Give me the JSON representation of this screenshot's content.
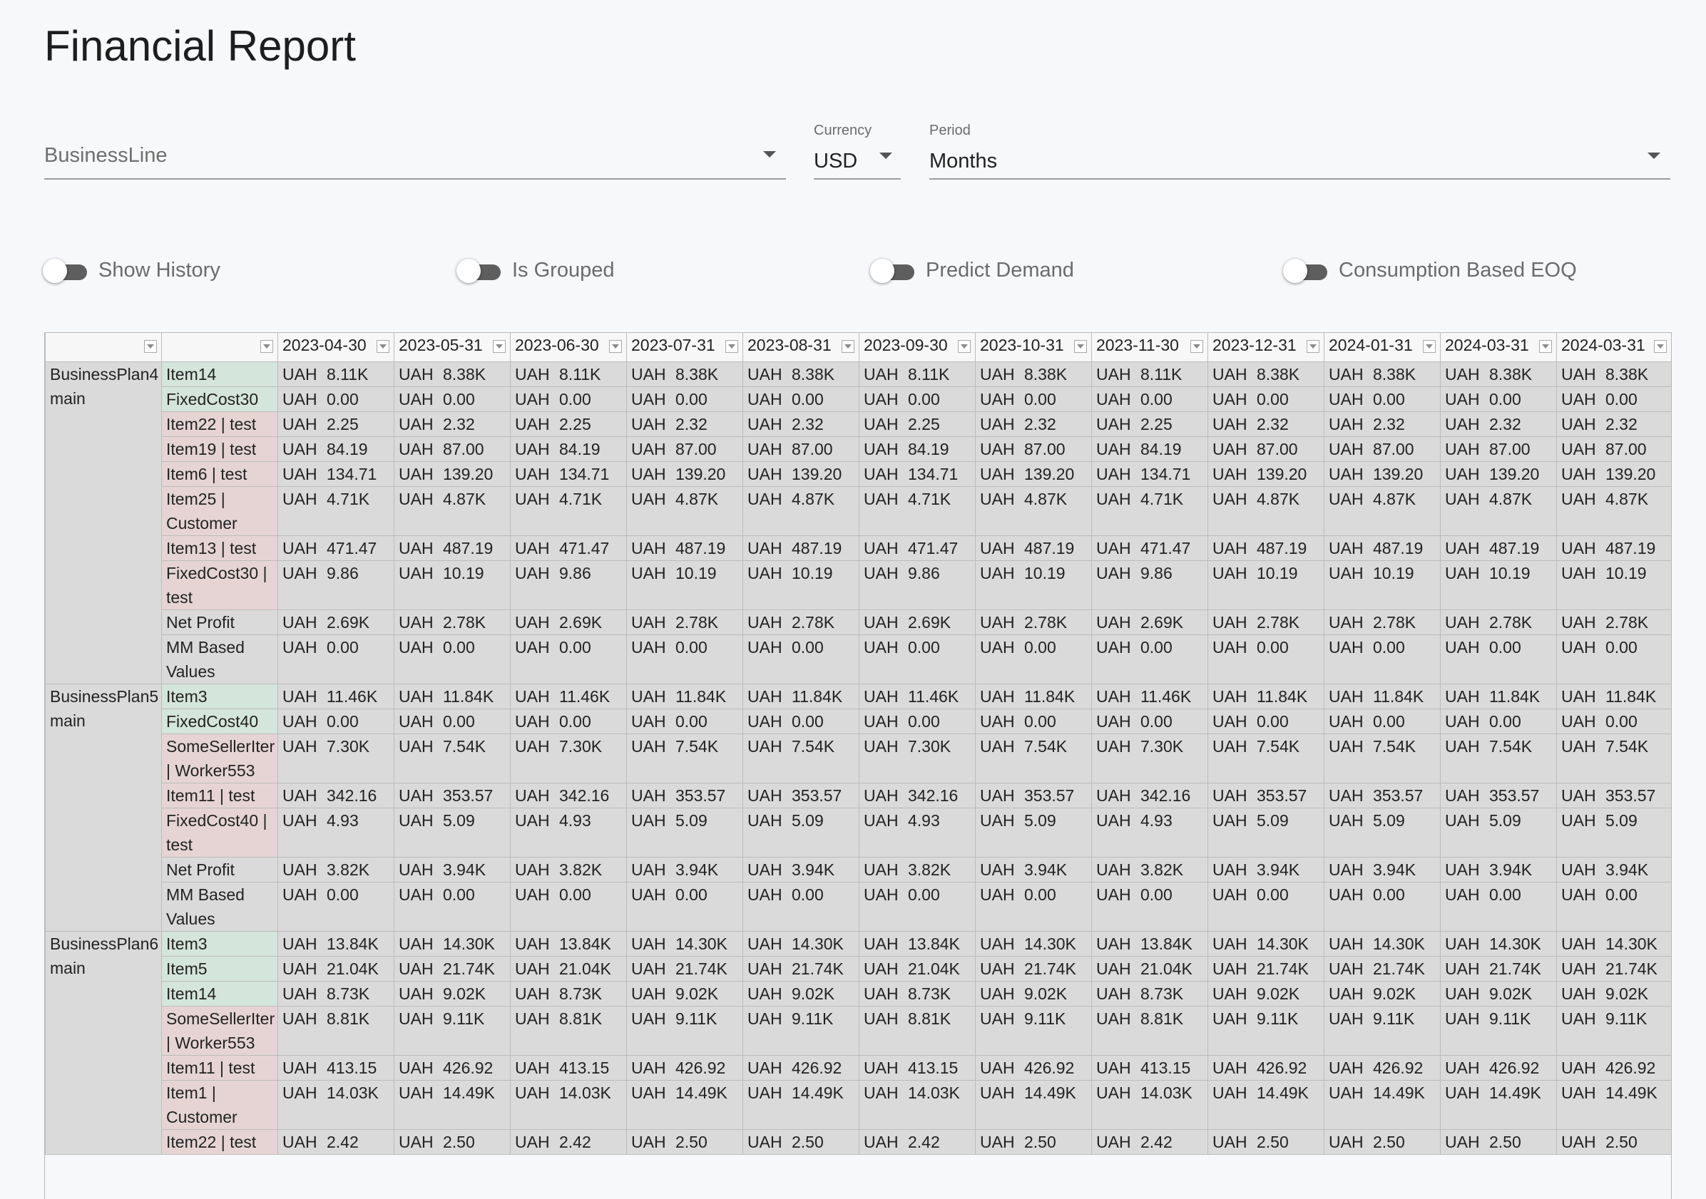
{
  "page": {
    "title": "Financial Report"
  },
  "filters": {
    "business_line": {
      "placeholder": "BusinessLine"
    },
    "currency": {
      "label": "Currency",
      "value": "USD"
    },
    "period": {
      "label": "Period",
      "value": "Months"
    }
  },
  "toggles": [
    {
      "label": "Show History",
      "on": false
    },
    {
      "label": "Is Grouped",
      "on": false
    },
    {
      "label": "Predict Demand",
      "on": false
    },
    {
      "label": "Consumption Based EOQ",
      "on": false
    }
  ],
  "colors": {
    "income_row": "#d4e5db",
    "cost_row": "#e6d4d4",
    "neutral_row": "#dadada"
  },
  "table": {
    "columns": [
      "2023-04-30",
      "2023-05-31",
      "2023-06-30",
      "2023-07-31",
      "2023-08-31",
      "2023-09-30",
      "2023-10-31",
      "2023-11-30",
      "2023-12-31",
      "2024-01-31",
      "2024-03-31",
      "2024-03-31"
    ],
    "groups": [
      {
        "plan": "BusinessPlan4 main",
        "rows": [
          {
            "label": "Item14",
            "kind": "green",
            "values": [
              "8.11K",
              "8.38K",
              "8.11K",
              "8.38K",
              "8.38K",
              "8.11K",
              "8.38K",
              "8.11K",
              "8.38K",
              "8.38K",
              "8.38K",
              "8.38K"
            ]
          },
          {
            "label": "FixedCost30",
            "kind": "green",
            "values": [
              "0.00",
              "0.00",
              "0.00",
              "0.00",
              "0.00",
              "0.00",
              "0.00",
              "0.00",
              "0.00",
              "0.00",
              "0.00",
              "0.00"
            ]
          },
          {
            "label": "Item22 | test",
            "kind": "red",
            "values": [
              "2.25",
              "2.32",
              "2.25",
              "2.32",
              "2.32",
              "2.25",
              "2.32",
              "2.25",
              "2.32",
              "2.32",
              "2.32",
              "2.32"
            ]
          },
          {
            "label": "Item19 | test",
            "kind": "red",
            "values": [
              "84.19",
              "87.00",
              "84.19",
              "87.00",
              "87.00",
              "84.19",
              "87.00",
              "84.19",
              "87.00",
              "87.00",
              "87.00",
              "87.00"
            ]
          },
          {
            "label": "Item6 | test",
            "kind": "red",
            "values": [
              "134.71",
              "139.20",
              "134.71",
              "139.20",
              "139.20",
              "134.71",
              "139.20",
              "134.71",
              "139.20",
              "139.20",
              "139.20",
              "139.20"
            ]
          },
          {
            "label": "Item25 | Customer",
            "kind": "red",
            "values": [
              "4.71K",
              "4.87K",
              "4.71K",
              "4.87K",
              "4.87K",
              "4.71K",
              "4.87K",
              "4.71K",
              "4.87K",
              "4.87K",
              "4.87K",
              "4.87K"
            ]
          },
          {
            "label": "Item13 | test",
            "kind": "red",
            "values": [
              "471.47",
              "487.19",
              "471.47",
              "487.19",
              "487.19",
              "471.47",
              "487.19",
              "471.47",
              "487.19",
              "487.19",
              "487.19",
              "487.19"
            ]
          },
          {
            "label": "FixedCost30 | test",
            "kind": "red",
            "values": [
              "9.86",
              "10.19",
              "9.86",
              "10.19",
              "10.19",
              "9.86",
              "10.19",
              "9.86",
              "10.19",
              "10.19",
              "10.19",
              "10.19"
            ]
          },
          {
            "label": "Net Profit",
            "kind": "neutral",
            "values": [
              "2.69K",
              "2.78K",
              "2.69K",
              "2.78K",
              "2.78K",
              "2.69K",
              "2.78K",
              "2.69K",
              "2.78K",
              "2.78K",
              "2.78K",
              "2.78K"
            ]
          },
          {
            "label": "MM Based Values",
            "kind": "neutral",
            "values": [
              "0.00",
              "0.00",
              "0.00",
              "0.00",
              "0.00",
              "0.00",
              "0.00",
              "0.00",
              "0.00",
              "0.00",
              "0.00",
              "0.00"
            ]
          }
        ]
      },
      {
        "plan": "BusinessPlan5 main",
        "rows": [
          {
            "label": "Item3",
            "kind": "green",
            "values": [
              "11.46K",
              "11.84K",
              "11.46K",
              "11.84K",
              "11.84K",
              "11.46K",
              "11.84K",
              "11.46K",
              "11.84K",
              "11.84K",
              "11.84K",
              "11.84K"
            ]
          },
          {
            "label": "FixedCost40",
            "kind": "green",
            "values": [
              "0.00",
              "0.00",
              "0.00",
              "0.00",
              "0.00",
              "0.00",
              "0.00",
              "0.00",
              "0.00",
              "0.00",
              "0.00",
              "0.00"
            ]
          },
          {
            "label": "SomeSellerIter | Worker553",
            "kind": "red",
            "values": [
              "7.30K",
              "7.54K",
              "7.30K",
              "7.54K",
              "7.54K",
              "7.30K",
              "7.54K",
              "7.30K",
              "7.54K",
              "7.54K",
              "7.54K",
              "7.54K"
            ]
          },
          {
            "label": "Item11 | test",
            "kind": "red",
            "values": [
              "342.16",
              "353.57",
              "342.16",
              "353.57",
              "353.57",
              "342.16",
              "353.57",
              "342.16",
              "353.57",
              "353.57",
              "353.57",
              "353.57"
            ]
          },
          {
            "label": "FixedCost40 | test",
            "kind": "red",
            "values": [
              "4.93",
              "5.09",
              "4.93",
              "5.09",
              "5.09",
              "4.93",
              "5.09",
              "4.93",
              "5.09",
              "5.09",
              "5.09",
              "5.09"
            ]
          },
          {
            "label": "Net Profit",
            "kind": "neutral",
            "values": [
              "3.82K",
              "3.94K",
              "3.82K",
              "3.94K",
              "3.94K",
              "3.82K",
              "3.94K",
              "3.82K",
              "3.94K",
              "3.94K",
              "3.94K",
              "3.94K"
            ]
          },
          {
            "label": "MM Based Values",
            "kind": "neutral",
            "values": [
              "0.00",
              "0.00",
              "0.00",
              "0.00",
              "0.00",
              "0.00",
              "0.00",
              "0.00",
              "0.00",
              "0.00",
              "0.00",
              "0.00"
            ]
          }
        ]
      },
      {
        "plan": "BusinessPlan6 main",
        "rows": [
          {
            "label": "Item3",
            "kind": "green",
            "values": [
              "13.84K",
              "14.30K",
              "13.84K",
              "14.30K",
              "14.30K",
              "13.84K",
              "14.30K",
              "13.84K",
              "14.30K",
              "14.30K",
              "14.30K",
              "14.30K"
            ]
          },
          {
            "label": "Item5",
            "kind": "green",
            "values": [
              "21.04K",
              "21.74K",
              "21.04K",
              "21.74K",
              "21.74K",
              "21.04K",
              "21.74K",
              "21.04K",
              "21.74K",
              "21.74K",
              "21.74K",
              "21.74K"
            ]
          },
          {
            "label": "Item14",
            "kind": "green",
            "values": [
              "8.73K",
              "9.02K",
              "8.73K",
              "9.02K",
              "9.02K",
              "8.73K",
              "9.02K",
              "8.73K",
              "9.02K",
              "9.02K",
              "9.02K",
              "9.02K"
            ]
          },
          {
            "label": "SomeSellerIter | Worker553",
            "kind": "red",
            "values": [
              "8.81K",
              "9.11K",
              "8.81K",
              "9.11K",
              "9.11K",
              "8.81K",
              "9.11K",
              "8.81K",
              "9.11K",
              "9.11K",
              "9.11K",
              "9.11K"
            ]
          },
          {
            "label": "Item11 | test",
            "kind": "red",
            "values": [
              "413.15",
              "426.92",
              "413.15",
              "426.92",
              "426.92",
              "413.15",
              "426.92",
              "413.15",
              "426.92",
              "426.92",
              "426.92",
              "426.92"
            ]
          },
          {
            "label": "Item1 | Customer",
            "kind": "red",
            "values": [
              "14.03K",
              "14.49K",
              "14.03K",
              "14.49K",
              "14.49K",
              "14.03K",
              "14.49K",
              "14.03K",
              "14.49K",
              "14.49K",
              "14.49K",
              "14.49K"
            ]
          },
          {
            "label": "Item22 | test",
            "kind": "red",
            "values": [
              "2.42",
              "2.50",
              "2.42",
              "2.50",
              "2.50",
              "2.42",
              "2.50",
              "2.42",
              "2.50",
              "2.50",
              "2.50",
              "2.50"
            ]
          }
        ]
      }
    ],
    "currency_label": "UAH"
  }
}
